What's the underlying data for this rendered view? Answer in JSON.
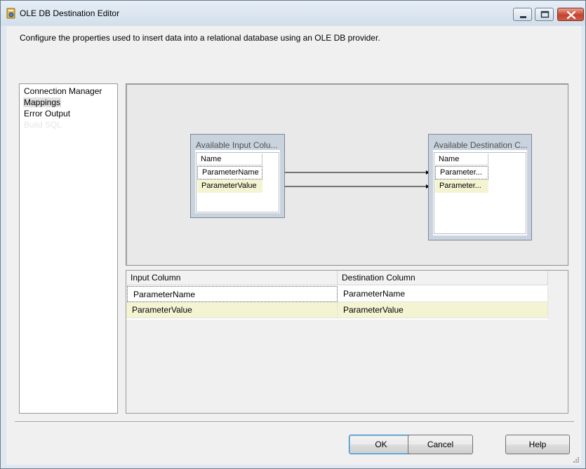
{
  "window": {
    "title": "OLE DB Destination Editor",
    "description": "Configure the properties used to insert data into a relational database using an OLE DB provider."
  },
  "nav": {
    "items": [
      {
        "label": "Connection Manager",
        "state": "normal"
      },
      {
        "label": "Mappings",
        "state": "selected"
      },
      {
        "label": "Error Output",
        "state": "normal"
      },
      {
        "label": "Build SQL",
        "state": "disabled"
      }
    ]
  },
  "mapping": {
    "input_table": {
      "title": "Available Input Colu...",
      "header": "Name",
      "rows": [
        "ParameterName",
        "ParameterValue"
      ]
    },
    "destination_table": {
      "title": "Available Destination C...",
      "header": "Name",
      "rows": [
        "Parameter...",
        "Parameter..."
      ]
    }
  },
  "grid": {
    "headers": [
      "Input Column",
      "Destination Column"
    ],
    "rows": [
      [
        "ParameterName",
        "ParameterName"
      ],
      [
        "ParameterValue",
        "ParameterValue"
      ]
    ]
  },
  "buttons": {
    "ok": "OK",
    "cancel": "Cancel",
    "help": "Help"
  },
  "icons": {
    "app": "ssis-destination-icon",
    "minimize": "minimize-icon",
    "maximize": "maximize-icon",
    "close": "close-icon"
  },
  "colors": {
    "alt_row": "#f4f4d3",
    "close_button": "#c5432c",
    "titlebar": "#d2dfeb"
  }
}
